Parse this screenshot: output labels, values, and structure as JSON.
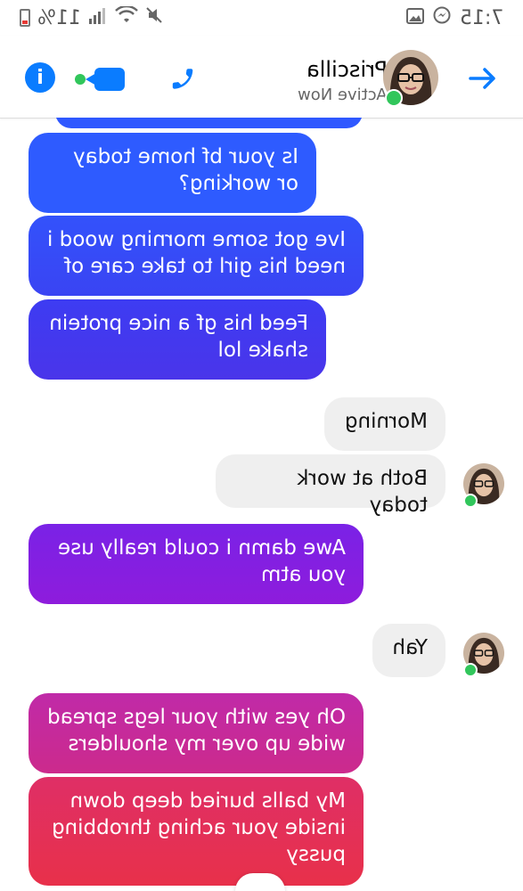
{
  "status_bar": {
    "time": "7:15",
    "battery_percent": "11%",
    "icons": [
      "gallery-icon",
      "messenger-icon",
      "battery-icon",
      "signal-icon",
      "wifi-icon",
      "mute-icon"
    ]
  },
  "header": {
    "contact_name": "Priscilla",
    "contact_status": "Active Now",
    "icons": [
      "info-icon",
      "video-call-icon",
      "phone-icon",
      "back-arrow-icon"
    ],
    "accent": "#0a7cff",
    "online_color": "#31c65b"
  },
  "messages": [
    {
      "side": "right",
      "text": "",
      "partial": true
    },
    {
      "side": "right",
      "text": "Is your bf home today or working?"
    },
    {
      "side": "right",
      "text": "Ive got some morning wood i need his girl to take care of"
    },
    {
      "side": "right",
      "text": "Feed his gf a nice protein shake lol"
    },
    {
      "side": "left",
      "text": "Morning"
    },
    {
      "side": "left",
      "text": "Both at work today"
    },
    {
      "side": "right",
      "text": "Awe damn i could really use you atm"
    },
    {
      "side": "left",
      "text": "Yah"
    },
    {
      "side": "right",
      "text": "Oh yes with your legs spread wide up over my shoulders"
    },
    {
      "side": "right",
      "text": "My balls buried deep down inside your aching throbbing pussy"
    }
  ],
  "bubble_colors": {
    "blue": "#2e5bff",
    "indigo": "#3a3cf0",
    "purple": "#8a1ee0",
    "magenta": "#c62a9e",
    "red": "#e8304a",
    "gray": "#efefef"
  }
}
